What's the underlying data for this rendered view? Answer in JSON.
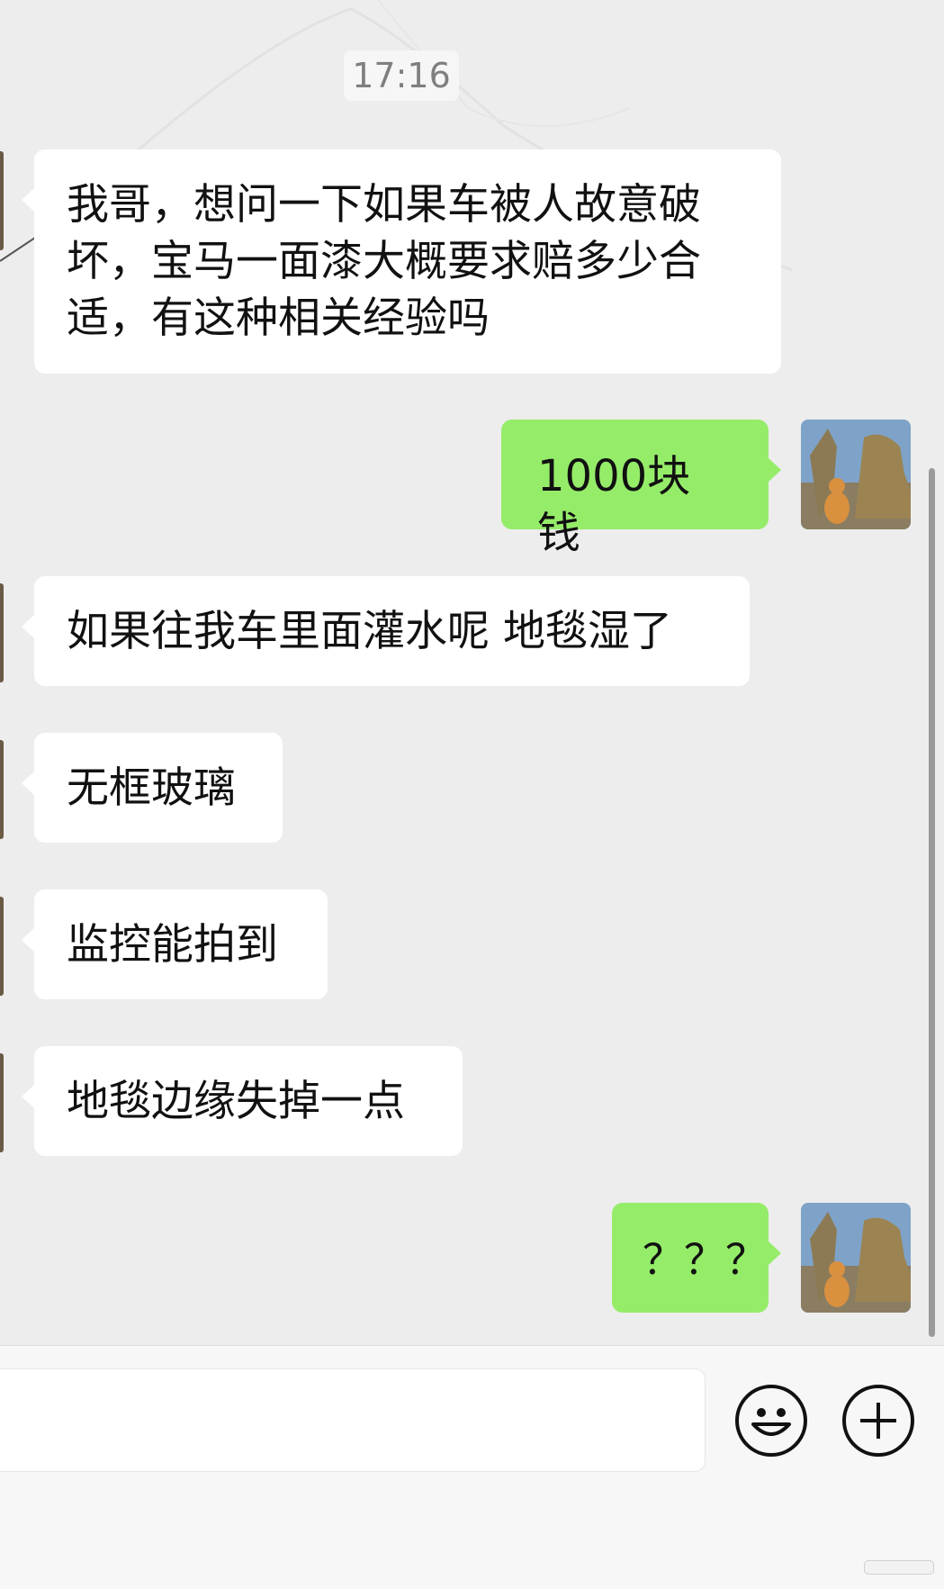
{
  "chat": {
    "timestamp": "17:16",
    "messages": [
      {
        "side": "in",
        "text": "我哥，想问一下如果车被人故意破坏，宝马一面漆大概要求赔多少合适，有这种相关经验吗"
      },
      {
        "side": "out",
        "text": "1000块钱"
      },
      {
        "side": "in",
        "text": "如果往我车里面灌水呢 地毯湿了"
      },
      {
        "side": "in",
        "text": "无框玻璃"
      },
      {
        "side": "in",
        "text": "监控能拍到"
      },
      {
        "side": "in",
        "text": "地毯边缘失掉一点"
      },
      {
        "side": "out",
        "text": "？？？"
      }
    ]
  },
  "input_bar": {
    "text_value": "",
    "emoji_icon": "smiley-face-icon",
    "more_icon": "plus-circle-icon"
  },
  "colors": {
    "background": "#ededed",
    "incoming_bubble": "#ffffff",
    "outgoing_bubble": "#95ec69"
  }
}
